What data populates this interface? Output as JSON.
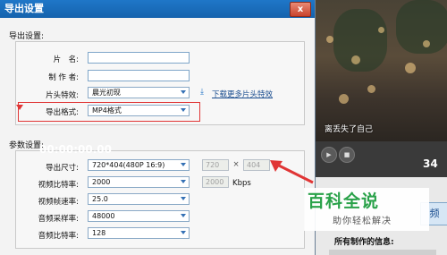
{
  "dialog": {
    "title": "导出设置",
    "close_glyph": "x",
    "export_section": {
      "title": "导出设置:",
      "name_label": "片　名:",
      "name_value": "",
      "author_label": "制 作 者:",
      "author_value": "",
      "intro_effect_label": "片头特效:",
      "intro_effect_value": "晨光初现",
      "download_link": "下载更多片头特效",
      "format_label": "导出格式:",
      "format_value": "MP4格式"
    },
    "params_section": {
      "title": "参数设置:",
      "size_label": "导出尺寸:",
      "size_value": "720*404(480P 16:9)",
      "width_value": "720",
      "times_glyph": "×",
      "height_value": "404",
      "video_bitrate_label": "视频比特率:",
      "video_bitrate_value": "2000",
      "custom_bitrate_value": "2000",
      "bitrate_unit": "Kbps",
      "framerate_label": "视频帧速率:",
      "framerate_value": "25.0",
      "audio_sample_label": "音频采样率:",
      "audio_sample_value": "48000",
      "audio_bitrate_label": "音频比特率:",
      "audio_bitrate_value": "128"
    }
  },
  "preview": {
    "subtitle": "离丢失了自己",
    "timecode_1": "00:00:00.00",
    "timecode_2": "34",
    "side_button": "频",
    "info_label": "所有制作的信息:"
  },
  "watermark": {
    "main": "百科全说",
    "sub": "助你轻松解决"
  },
  "icons": {
    "download": "download-arrow-icon",
    "close": "close-icon",
    "dropdown": "chevron-down-icon"
  },
  "colors": {
    "titlebar": "#1f77c8",
    "highlight": "#e03535",
    "watermark_green": "#2aa24a"
  }
}
